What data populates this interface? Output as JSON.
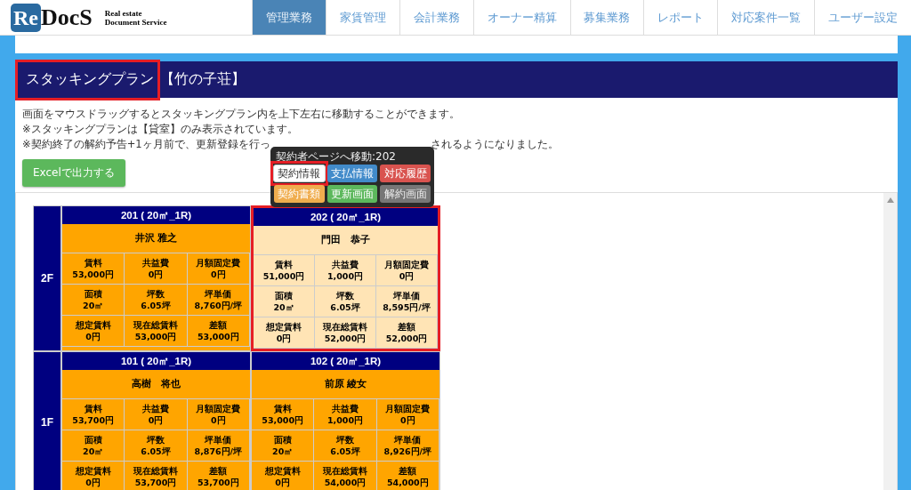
{
  "header": {
    "logo": {
      "mark": "Re",
      "word": "DocS",
      "tagline_1": "Real estate",
      "tagline_2": "Document Service"
    },
    "nav": [
      {
        "label": "管理業務",
        "selected": true
      },
      {
        "label": "家賃管理",
        "selected": false
      },
      {
        "label": "会計業務",
        "selected": false
      },
      {
        "label": "オーナー精算",
        "selected": false
      },
      {
        "label": "募集業務",
        "selected": false
      },
      {
        "label": "レポート",
        "selected": false
      },
      {
        "label": "対応案件一覧",
        "selected": false
      },
      {
        "label": "ユーザー設定",
        "selected": false
      }
    ]
  },
  "page": {
    "title": "スタッキングプラン",
    "title_highlighted": true,
    "property": "【竹の子荘】",
    "notices": [
      {
        "parts": [
          "画面をマウスドラッグするとスタッキングプラン内を上下左右に移動することができます。"
        ]
      },
      {
        "parts": [
          "※スタッキングプランは【貸室】のみ表示されています。"
        ]
      },
      {
        "parts": [
          "※契約終了の解約予告+1ヶ月前で、更新登録を行っ",
          "されるようになりました。"
        ]
      }
    ],
    "export_button": "Excelで出力する"
  },
  "popup": {
    "title": "契約者ページへ移動:202",
    "buttons": [
      {
        "label": "契約情報",
        "kind": "default",
        "highlighted": true
      },
      {
        "label": "支払情報",
        "kind": "primary",
        "highlighted": false
      },
      {
        "label": "対応履歴",
        "kind": "danger",
        "highlighted": false
      },
      {
        "label": "契約書類",
        "kind": "warning",
        "highlighted": false
      },
      {
        "label": "更新画面",
        "kind": "success",
        "highlighted": false
      },
      {
        "label": "解約画面",
        "kind": "secondary",
        "highlighted": false
      }
    ]
  },
  "floors": [
    {
      "label": "2F",
      "units": [
        {
          "header": "201 ( 20㎡_1R)",
          "tenant": "井沢 雅之",
          "selected": false,
          "highlighted": false,
          "cells": [
            {
              "label": "賃料",
              "value": "53,000円"
            },
            {
              "label": "共益費",
              "value": "0円"
            },
            {
              "label": "月額固定費",
              "value": "0円"
            },
            {
              "label": "面積",
              "value": "20㎡"
            },
            {
              "label": "坪数",
              "value": "6.05坪"
            },
            {
              "label": "坪単価",
              "value": "8,760円/坪"
            },
            {
              "label": "想定賃料",
              "value": "0円"
            },
            {
              "label": "現在総賃料",
              "value": "53,000円"
            },
            {
              "label": "差額",
              "value": "53,000円"
            }
          ]
        },
        {
          "header": "202 ( 20㎡_1R)",
          "tenant": "門田　恭子",
          "selected": true,
          "highlighted": true,
          "cells": [
            {
              "label": "賃料",
              "value": "51,000円"
            },
            {
              "label": "共益費",
              "value": "1,000円"
            },
            {
              "label": "月額固定費",
              "value": "0円"
            },
            {
              "label": "面積",
              "value": "20㎡"
            },
            {
              "label": "坪数",
              "value": "6.05坪"
            },
            {
              "label": "坪単価",
              "value": "8,595円/坪"
            },
            {
              "label": "想定賃料",
              "value": "0円"
            },
            {
              "label": "現在総賃料",
              "value": "52,000円"
            },
            {
              "label": "差額",
              "value": "52,000円"
            }
          ]
        }
      ]
    },
    {
      "label": "1F",
      "units": [
        {
          "header": "101 ( 20㎡_1R)",
          "tenant": "高樹　将也",
          "selected": false,
          "highlighted": false,
          "cells": [
            {
              "label": "賃料",
              "value": "53,700円"
            },
            {
              "label": "共益費",
              "value": "0円"
            },
            {
              "label": "月額固定費",
              "value": "0円"
            },
            {
              "label": "面積",
              "value": "20㎡"
            },
            {
              "label": "坪数",
              "value": "6.05坪"
            },
            {
              "label": "坪単価",
              "value": "8,876円/坪"
            },
            {
              "label": "想定賃料",
              "value": "0円"
            },
            {
              "label": "現在総賃料",
              "value": "53,700円"
            },
            {
              "label": "差額",
              "value": "53,700円"
            }
          ]
        },
        {
          "header": "102 ( 20㎡_1R)",
          "tenant": "前原 綾女",
          "selected": false,
          "highlighted": false,
          "cells": [
            {
              "label": "賃料",
              "value": "53,000円"
            },
            {
              "label": "共益費",
              "value": "1,000円"
            },
            {
              "label": "月額固定費",
              "value": "0円"
            },
            {
              "label": "面積",
              "value": "20㎡"
            },
            {
              "label": "坪数",
              "value": "6.05坪"
            },
            {
              "label": "坪単価",
              "value": "8,926円/坪"
            },
            {
              "label": "想定賃料",
              "value": "0円"
            },
            {
              "label": "現在総賃料",
              "value": "54,000円"
            },
            {
              "label": "差額",
              "value": "54,000円"
            }
          ]
        }
      ]
    }
  ]
}
